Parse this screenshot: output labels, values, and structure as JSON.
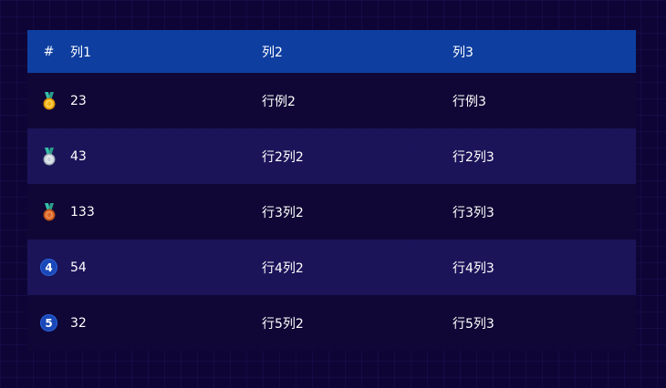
{
  "table": {
    "header": {
      "index": "#",
      "col1": "列1",
      "col2": "列2",
      "col3": "列3"
    },
    "rows": [
      {
        "rank_icon": "gold-medal-icon",
        "col1": "23",
        "col2": "行例2",
        "col3": "行例3"
      },
      {
        "rank_icon": "silver-medal-icon",
        "col1": "43",
        "col2": "行2列2",
        "col3": "行2列3"
      },
      {
        "rank_icon": "bronze-medal-icon",
        "col1": "133",
        "col2": "行3列2",
        "col3": "行3列3"
      },
      {
        "rank": "4",
        "col1": "54",
        "col2": "行4列2",
        "col3": "行4列3"
      },
      {
        "rank": "5",
        "col1": "32",
        "col2": "行5列2",
        "col3": "行5列3"
      }
    ]
  },
  "colors": {
    "background": "#0e0536",
    "header_bg": "#0e3fa0",
    "row_odd": "#100836",
    "row_even": "#1c165c",
    "rank_badge": "#1a48b8",
    "gold": "#f5b21a",
    "silver": "#c9d3dc",
    "bronze": "#d9692a",
    "ribbon": "#35c0a8"
  }
}
